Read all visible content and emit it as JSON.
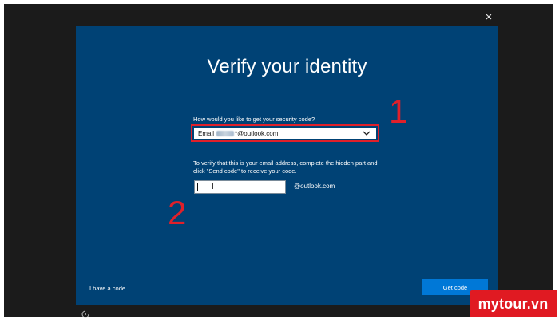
{
  "window": {
    "close_icon": "×"
  },
  "dialog": {
    "title": "Verify your identity",
    "question": "How would you like to get your security code?",
    "selected_option": {
      "prefix": "Email",
      "suffix": "*@outlook.com"
    },
    "instructions": "To verify that this is your email address, complete the hidden part and click \"Send code\" to receive your code.",
    "email_input": {
      "value": "",
      "domain_suffix": "@outlook.com"
    },
    "have_code_link": "I have a code",
    "get_code_button": "Get code"
  },
  "annotations": {
    "step1": "1",
    "step2": "2",
    "highlight_color": "#e0202a"
  },
  "ease_of_access_icon": "ease-of-access-icon",
  "watermark": "mytour.vn",
  "colors": {
    "panel_bg": "#004275",
    "button_bg": "#0078d7",
    "frame_bg": "#1b1b1b"
  }
}
